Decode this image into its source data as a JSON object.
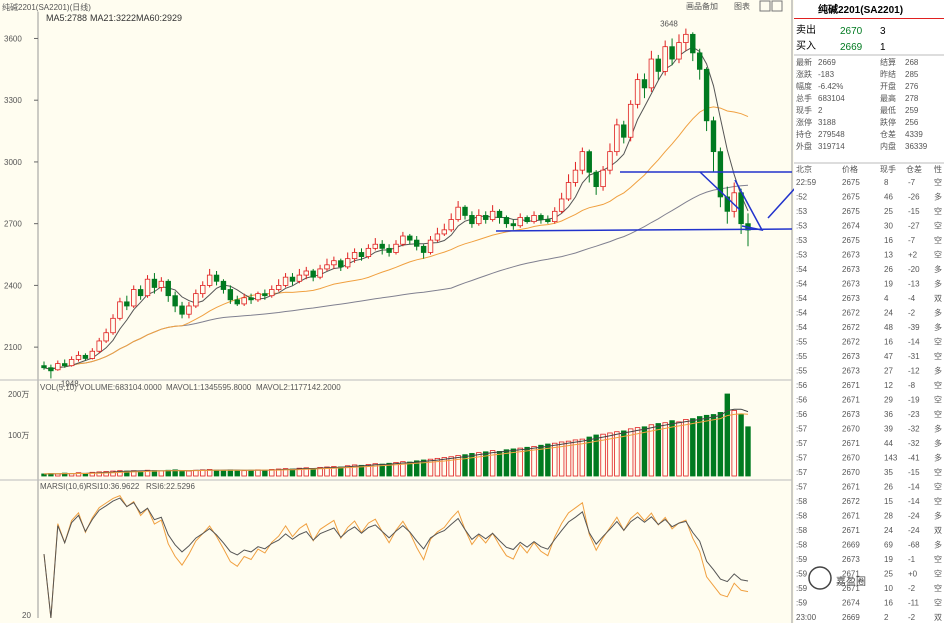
{
  "header": {
    "instrument": "纯碱2201(SA2201)(日线)",
    "ma_label": "MA5:2788",
    "ma21_label": "MA21:3222",
    "ma60_label": "MA60:2929",
    "btn_history": "画品备加",
    "btn_chart": "图表"
  },
  "vol_header": {
    "vol": "VOL(5,10) VOLUME:683104.0000",
    "mavol1": "MAVOL1:1345595.8000",
    "mavol2": "MAVOL2:1177142.2000"
  },
  "rsi_header": {
    "name": "MARSI(10,6)",
    "rsi10": "RSI10:36.9622",
    "rsi6": "RSI6:22.5296"
  },
  "price_axis": [
    "3600",
    "3300",
    "3000",
    "2700",
    "2400",
    "2100"
  ],
  "vol_axis": [
    "200万",
    "100万"
  ],
  "rsi_axis": [
    "20"
  ],
  "annotations": {
    "high": "3648",
    "low": "1948"
  },
  "chart_data": {
    "type": "candlestick",
    "ylim": [
      1950,
      3680
    ],
    "candles": [
      [
        2010,
        2000,
        2030,
        1990
      ],
      [
        2000,
        1985,
        2015,
        1948
      ],
      [
        1990,
        2020,
        2035,
        1985
      ],
      [
        2020,
        2010,
        2040,
        2000
      ],
      [
        2010,
        2040,
        2055,
        2005
      ],
      [
        2040,
        2060,
        2080,
        2030
      ],
      [
        2060,
        2045,
        2070,
        2035
      ],
      [
        2045,
        2080,
        2095,
        2040
      ],
      [
        2080,
        2130,
        2145,
        2070
      ],
      [
        2130,
        2170,
        2190,
        2120
      ],
      [
        2170,
        2240,
        2260,
        2160
      ],
      [
        2240,
        2320,
        2340,
        2230
      ],
      [
        2320,
        2300,
        2350,
        2280
      ],
      [
        2300,
        2380,
        2400,
        2290
      ],
      [
        2380,
        2350,
        2400,
        2330
      ],
      [
        2350,
        2430,
        2450,
        2340
      ],
      [
        2430,
        2390,
        2460,
        2360
      ],
      [
        2390,
        2420,
        2440,
        2370
      ],
      [
        2420,
        2350,
        2430,
        2320
      ],
      [
        2350,
        2300,
        2370,
        2270
      ],
      [
        2300,
        2260,
        2320,
        2240
      ],
      [
        2260,
        2300,
        2320,
        2240
      ],
      [
        2300,
        2360,
        2380,
        2290
      ],
      [
        2360,
        2400,
        2420,
        2340
      ],
      [
        2400,
        2450,
        2480,
        2390
      ],
      [
        2450,
        2420,
        2470,
        2400
      ],
      [
        2420,
        2380,
        2430,
        2360
      ],
      [
        2380,
        2330,
        2400,
        2310
      ],
      [
        2330,
        2310,
        2350,
        2300
      ],
      [
        2310,
        2340,
        2360,
        2300
      ],
      [
        2340,
        2330,
        2360,
        2310
      ],
      [
        2330,
        2360,
        2370,
        2320
      ],
      [
        2360,
        2350,
        2380,
        2330
      ],
      [
        2350,
        2380,
        2400,
        2340
      ],
      [
        2380,
        2400,
        2430,
        2370
      ],
      [
        2400,
        2440,
        2460,
        2390
      ],
      [
        2440,
        2420,
        2460,
        2400
      ],
      [
        2420,
        2450,
        2480,
        2410
      ],
      [
        2450,
        2470,
        2490,
        2430
      ],
      [
        2470,
        2440,
        2480,
        2420
      ],
      [
        2440,
        2480,
        2500,
        2430
      ],
      [
        2480,
        2500,
        2530,
        2470
      ],
      [
        2500,
        2520,
        2540,
        2480
      ],
      [
        2520,
        2490,
        2530,
        2470
      ],
      [
        2490,
        2530,
        2560,
        2480
      ],
      [
        2530,
        2560,
        2580,
        2510
      ],
      [
        2560,
        2540,
        2580,
        2520
      ],
      [
        2540,
        2580,
        2600,
        2530
      ],
      [
        2580,
        2600,
        2630,
        2570
      ],
      [
        2600,
        2580,
        2620,
        2550
      ],
      [
        2580,
        2560,
        2600,
        2540
      ],
      [
        2560,
        2600,
        2620,
        2550
      ],
      [
        2600,
        2640,
        2660,
        2590
      ],
      [
        2640,
        2620,
        2650,
        2600
      ],
      [
        2620,
        2590,
        2640,
        2570
      ],
      [
        2590,
        2560,
        2600,
        2530
      ],
      [
        2560,
        2620,
        2640,
        2550
      ],
      [
        2620,
        2650,
        2680,
        2610
      ],
      [
        2650,
        2670,
        2700,
        2640
      ],
      [
        2670,
        2720,
        2750,
        2660
      ],
      [
        2720,
        2780,
        2810,
        2710
      ],
      [
        2780,
        2740,
        2790,
        2720
      ],
      [
        2740,
        2700,
        2760,
        2680
      ],
      [
        2700,
        2740,
        2770,
        2690
      ],
      [
        2740,
        2720,
        2760,
        2700
      ],
      [
        2720,
        2760,
        2790,
        2710
      ],
      [
        2760,
        2730,
        2770,
        2700
      ],
      [
        2730,
        2700,
        2740,
        2680
      ],
      [
        2700,
        2690,
        2720,
        2670
      ],
      [
        2690,
        2730,
        2750,
        2680
      ],
      [
        2730,
        2710,
        2740,
        2700
      ],
      [
        2710,
        2740,
        2760,
        2700
      ],
      [
        2740,
        2720,
        2750,
        2700
      ],
      [
        2720,
        2710,
        2740,
        2700
      ],
      [
        2710,
        2760,
        2780,
        2700
      ],
      [
        2760,
        2820,
        2850,
        2750
      ],
      [
        2820,
        2900,
        2940,
        2810
      ],
      [
        2900,
        2960,
        3000,
        2880
      ],
      [
        2960,
        3050,
        3070,
        2940
      ],
      [
        3050,
        2950,
        3060,
        2900
      ],
      [
        2950,
        2880,
        2960,
        2840
      ],
      [
        2880,
        2960,
        2980,
        2860
      ],
      [
        2960,
        3050,
        3090,
        2940
      ],
      [
        3050,
        3180,
        3210,
        3030
      ],
      [
        3180,
        3120,
        3200,
        3090
      ],
      [
        3120,
        3280,
        3300,
        3100
      ],
      [
        3280,
        3400,
        3430,
        3260
      ],
      [
        3400,
        3360,
        3430,
        3310
      ],
      [
        3360,
        3500,
        3540,
        3340
      ],
      [
        3500,
        3440,
        3520,
        3400
      ],
      [
        3440,
        3560,
        3590,
        3420
      ],
      [
        3560,
        3500,
        3600,
        3470
      ],
      [
        3500,
        3580,
        3620,
        3480
      ],
      [
        3580,
        3620,
        3648,
        3540
      ],
      [
        3620,
        3530,
        3630,
        3490
      ],
      [
        3530,
        3450,
        3550,
        3400
      ],
      [
        3450,
        3200,
        3460,
        3150
      ],
      [
        3200,
        3050,
        3220,
        2950
      ],
      [
        3050,
        2830,
        3070,
        2780
      ],
      [
        2830,
        2760,
        2880,
        2700
      ],
      [
        2760,
        2850,
        2900,
        2730
      ],
      [
        2850,
        2700,
        2870,
        2650
      ],
      [
        2700,
        2669,
        2750,
        2590
      ]
    ],
    "volume": [
      5,
      6,
      5,
      7,
      6,
      8,
      6,
      9,
      10,
      11,
      12,
      13,
      12,
      13,
      12,
      14,
      13,
      12,
      14,
      15,
      13,
      12,
      14,
      15,
      16,
      14,
      13,
      15,
      14,
      13,
      14,
      15,
      14,
      16,
      17,
      18,
      17,
      19,
      20,
      18,
      21,
      22,
      23,
      22,
      25,
      27,
      26,
      28,
      30,
      29,
      31,
      33,
      35,
      34,
      37,
      39,
      41,
      43,
      45,
      47,
      50,
      52,
      55,
      57,
      59,
      62,
      60,
      64,
      66,
      68,
      70,
      72,
      75,
      78,
      80,
      83,
      85,
      88,
      90,
      95,
      100,
      102,
      105,
      108,
      110,
      115,
      118,
      120,
      125,
      128,
      130,
      135,
      132,
      138,
      140,
      145,
      148,
      150,
      155,
      200,
      160,
      150,
      120
    ],
    "rsi_levels": [
      20,
      80
    ]
  },
  "panel": {
    "title": "纯碱2201(SA2201)",
    "ask_label": "卖出",
    "ask_price": "2670",
    "ask_vol": "3",
    "bid_label": "买入",
    "bid_price": "2669",
    "bid_vol": "1",
    "stats": [
      [
        "最新",
        "2669",
        "结算",
        "268"
      ],
      [
        "涨跌",
        "-183",
        "昨结",
        "285"
      ],
      [
        "幅度",
        "-6.42%",
        "开盘",
        "276"
      ],
      [
        "总手",
        "683104",
        "最高",
        "278"
      ],
      [
        "现手",
        "2",
        "最低",
        "259"
      ],
      [
        "涨停",
        "3188",
        "跌停",
        "256"
      ],
      [
        "持仓",
        "279548",
        "仓差",
        "4339"
      ],
      [
        "外盘",
        "319714",
        "内盘",
        "36339"
      ]
    ],
    "tick_header": [
      "北京",
      "价格",
      "现手",
      "仓差",
      "性"
    ],
    "ticks": [
      [
        "22:59",
        "2675",
        "8",
        "-7",
        "空"
      ],
      [
        ":52",
        "2675",
        "46",
        "-26",
        "多"
      ],
      [
        ":53",
        "2675",
        "25",
        "-15",
        "空"
      ],
      [
        ":53",
        "2674",
        "30",
        "-27",
        "空"
      ],
      [
        ":53",
        "2675",
        "16",
        "-7",
        "空"
      ],
      [
        ":53",
        "2673",
        "13",
        "+2",
        "空"
      ],
      [
        ":54",
        "2673",
        "26",
        "-20",
        "多"
      ],
      [
        ":54",
        "2673",
        "19",
        "-13",
        "多"
      ],
      [
        ":54",
        "2673",
        "4",
        "-4",
        "双"
      ],
      [
        ":54",
        "2672",
        "24",
        "-2",
        "多"
      ],
      [
        ":54",
        "2672",
        "48",
        "-39",
        "多"
      ],
      [
        ":55",
        "2672",
        "16",
        "-14",
        "空"
      ],
      [
        ":55",
        "2673",
        "47",
        "-31",
        "空"
      ],
      [
        ":55",
        "2673",
        "27",
        "-12",
        "多"
      ],
      [
        ":56",
        "2671",
        "12",
        "-8",
        "空"
      ],
      [
        ":56",
        "2671",
        "29",
        "-19",
        "空"
      ],
      [
        ":56",
        "2673",
        "36",
        "-23",
        "空"
      ],
      [
        ":57",
        "2670",
        "39",
        "-32",
        "多"
      ],
      [
        ":57",
        "2671",
        "44",
        "-32",
        "多"
      ],
      [
        ":57",
        "2670",
        "143",
        "-41",
        "多"
      ],
      [
        ":57",
        "2670",
        "35",
        "-15",
        "空"
      ],
      [
        ":57",
        "2671",
        "26",
        "-14",
        "空"
      ],
      [
        ":58",
        "2672",
        "15",
        "-14",
        "空"
      ],
      [
        ":58",
        "2671",
        "28",
        "-24",
        "多"
      ],
      [
        ":58",
        "2671",
        "24",
        "-24",
        "双"
      ],
      [
        ":58",
        "2669",
        "69",
        "-68",
        "多"
      ],
      [
        ":59",
        "2673",
        "19",
        "-1",
        "空"
      ],
      [
        ":59",
        "2671",
        "25",
        "+0",
        "空"
      ],
      [
        ":59",
        "2671",
        "10",
        "-2",
        "空"
      ],
      [
        ":59",
        "2674",
        "16",
        "-11",
        "空"
      ],
      [
        "23:00",
        "2669",
        "2",
        "-2",
        "双"
      ]
    ],
    "watermark": "嘉盈圈"
  },
  "colors": {
    "up": "#e02020",
    "down": "#007a20",
    "ma5": "#555555",
    "ma21": "#f0a040",
    "ma60": "#808090",
    "line": "#2233cc"
  }
}
